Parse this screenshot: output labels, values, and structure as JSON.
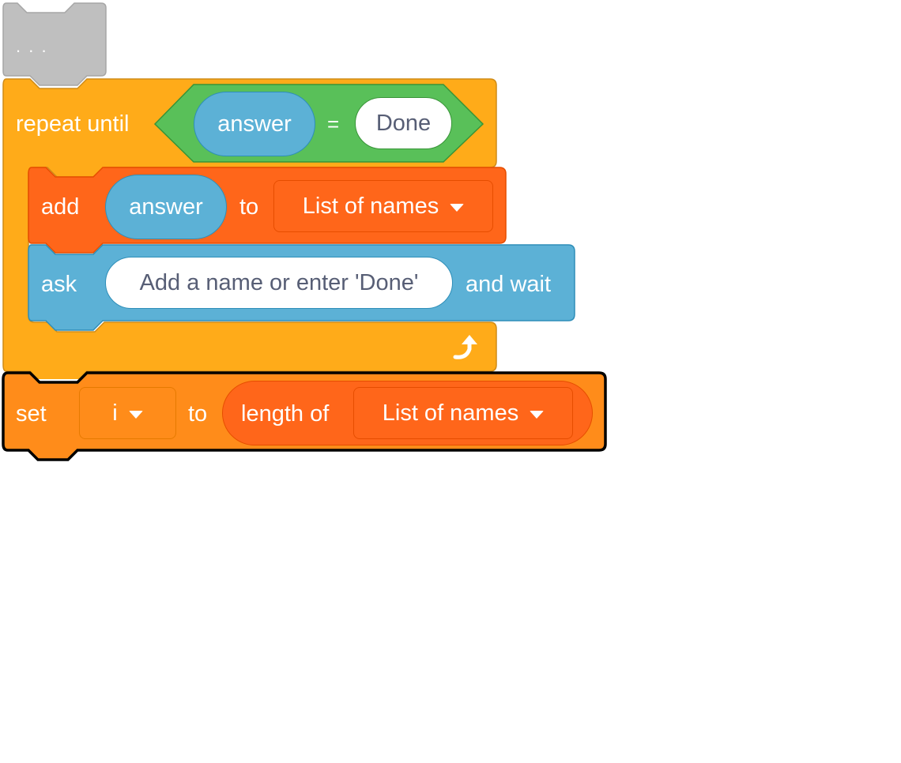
{
  "hat_block": {
    "label": ". . .",
    "color": "#bfbfbf"
  },
  "repeat_until_block": {
    "label": "repeat until",
    "color": "#ffab19",
    "condition": {
      "color": "#59c059",
      "operator": "=",
      "left_reporter": "answer",
      "right_value": "Done"
    },
    "loop_icon": "loop-arrow-icon"
  },
  "add_block": {
    "label_add": "add",
    "reporter": "answer",
    "label_to": "to",
    "list_dropdown": "List of names",
    "color": "#ff661a"
  },
  "ask_block": {
    "label_ask": "ask",
    "question": "Add a name or enter 'Done'",
    "label_wait": "and wait",
    "color": "#5cb1d6"
  },
  "set_block": {
    "label_set": "set",
    "variable_dropdown": "i",
    "label_to": "to",
    "color": "#ff8c1a",
    "reporter": {
      "label": "length of",
      "list_dropdown": "List of names",
      "color": "#ff661a"
    }
  }
}
